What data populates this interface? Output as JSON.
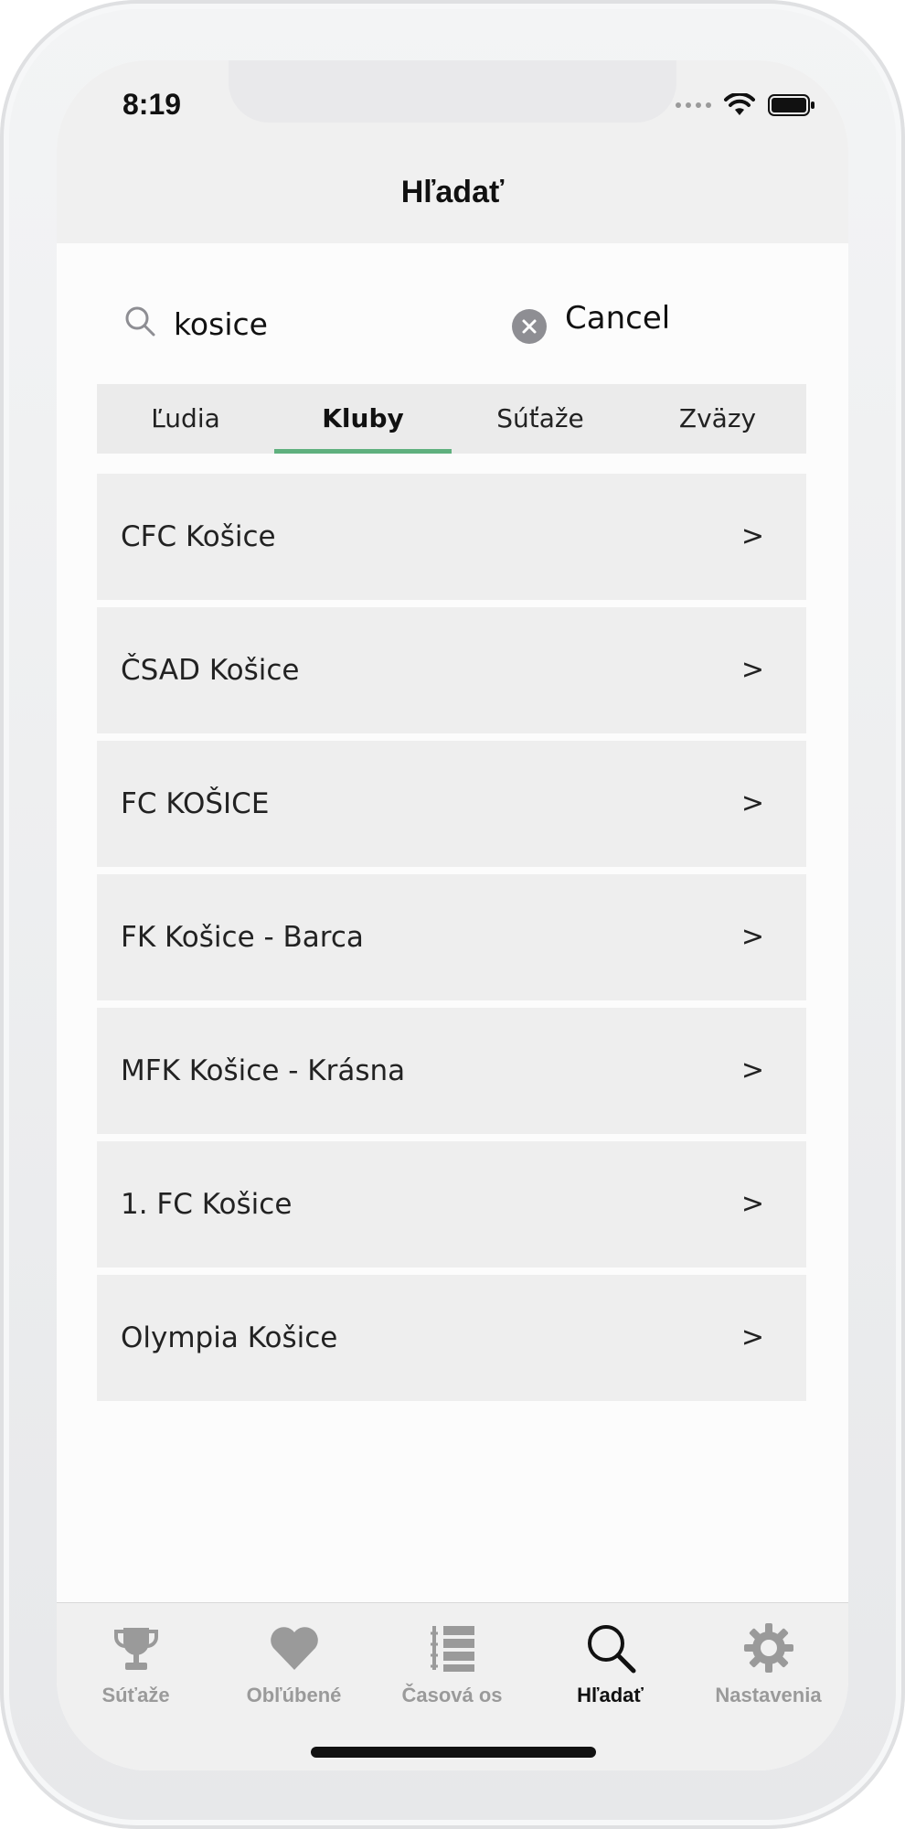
{
  "status_bar": {
    "time": "8:19"
  },
  "nav": {
    "title": "Hľadať"
  },
  "search": {
    "value": "kosice",
    "cancel_label": "Cancel"
  },
  "tabs": [
    {
      "label": "Ľudia",
      "active": false
    },
    {
      "label": "Kluby",
      "active": true
    },
    {
      "label": "Súťaže",
      "active": false
    },
    {
      "label": "Zväzy",
      "active": false
    }
  ],
  "results": [
    {
      "name": "CFC Košice",
      "chevron": ">"
    },
    {
      "name": "ČSAD Košice",
      "chevron": ">"
    },
    {
      "name": "FC KOŠICE",
      "chevron": ">"
    },
    {
      "name": "FK Košice - Barca",
      "chevron": ">"
    },
    {
      "name": "MFK Košice - Krásna",
      "chevron": ">"
    },
    {
      "name": "1. FC Košice",
      "chevron": ">"
    },
    {
      "name": "Olympia Košice",
      "chevron": ">"
    }
  ],
  "tabbar": [
    {
      "label": "Súťaže",
      "icon": "trophy-icon",
      "active": false
    },
    {
      "label": "Obľúbené",
      "icon": "heart-icon",
      "active": false
    },
    {
      "label": "Časová os",
      "icon": "timeline-icon",
      "active": false
    },
    {
      "label": "Hľadať",
      "icon": "search-icon",
      "active": true
    },
    {
      "label": "Nastavenia",
      "icon": "gear-icon",
      "active": false
    }
  ],
  "colors": {
    "accent": "#5fb07e",
    "tab_inactive": "#9a9a9a",
    "row_bg": "#eeeeee"
  }
}
